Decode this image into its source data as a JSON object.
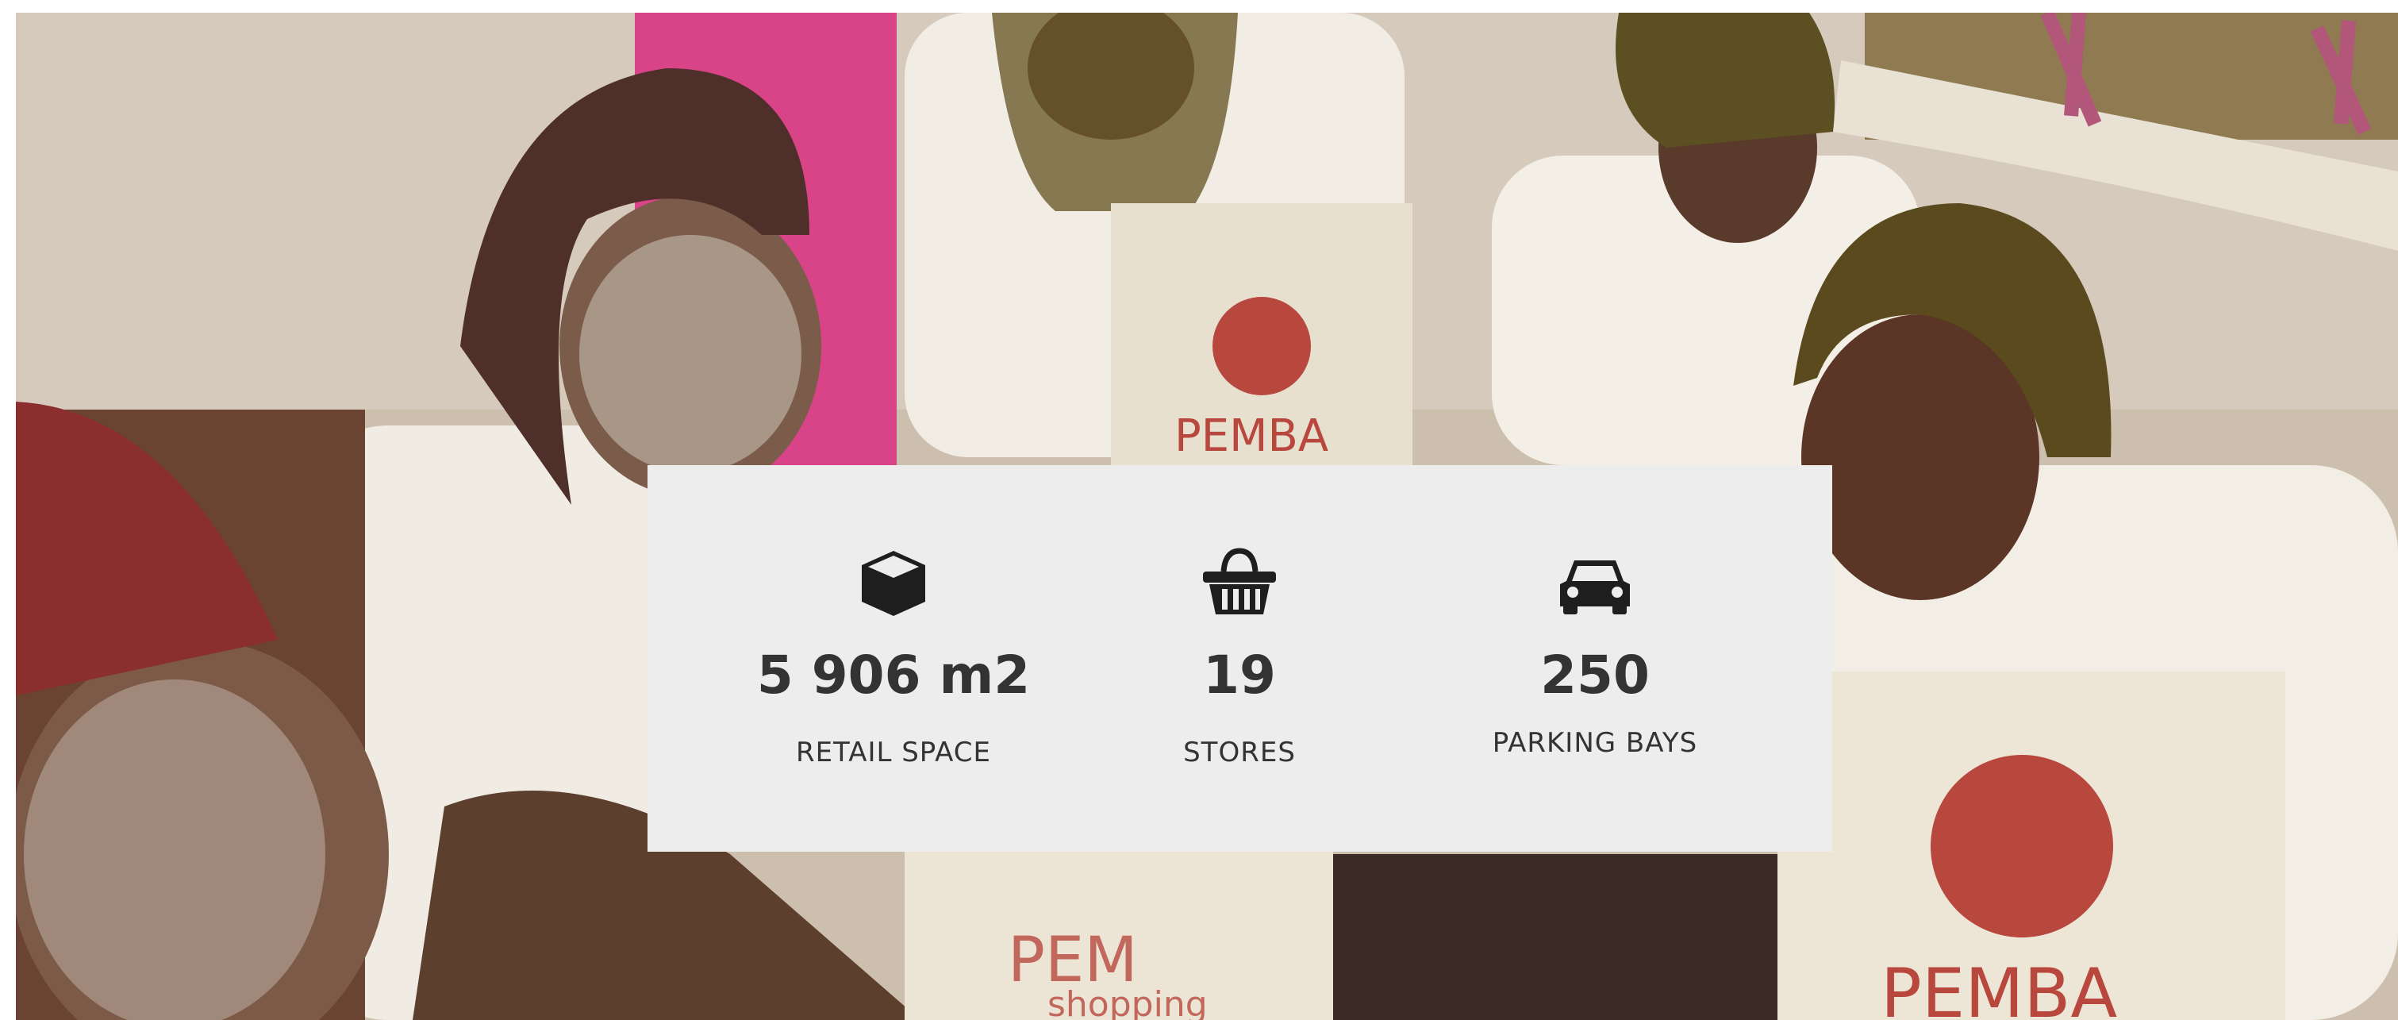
{
  "hero": {
    "image_label": "Women wearing traditional headscarves and white face paint holding PEMBA shopping tote bags",
    "bag_brand": "PEMBA",
    "bag_subtitle": "shopping"
  },
  "stats": [
    {
      "icon": "cube-icon",
      "value": "5 906 m2",
      "label": "RETAIL SPACE"
    },
    {
      "icon": "basket-icon",
      "value": "19",
      "label": "STORES"
    },
    {
      "icon": "car-icon",
      "value": "250",
      "label": "PARKING BAYS"
    }
  ],
  "colors": {
    "panel_background": "#ededed",
    "text": "#333333",
    "brand_red": "#b8473d",
    "bag_cream": "#ece4d4"
  }
}
